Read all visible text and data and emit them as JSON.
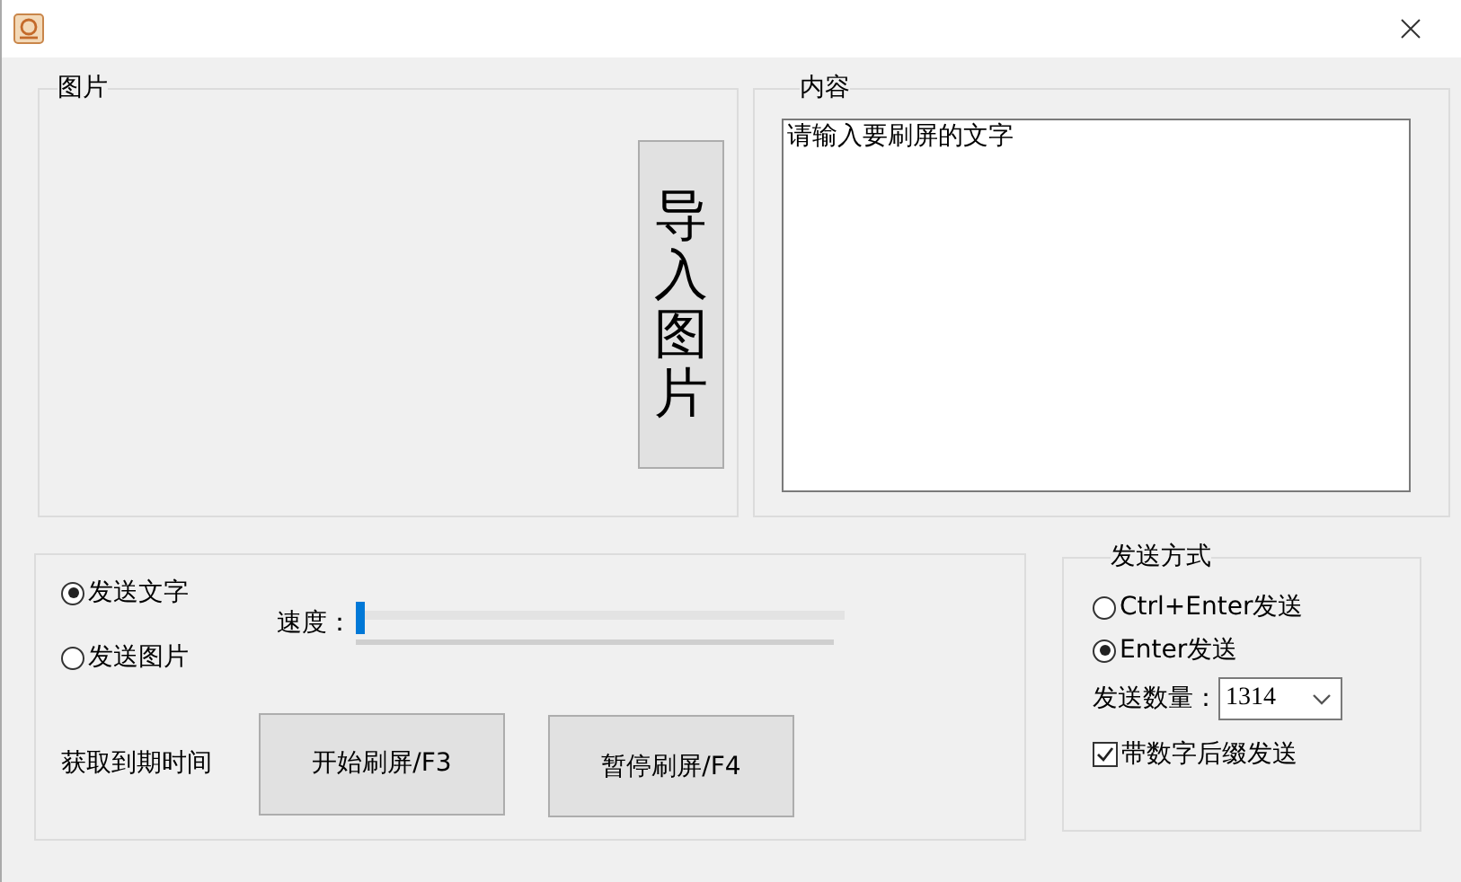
{
  "picture_group": {
    "label": "图片",
    "import_button": "导入图片"
  },
  "content_group": {
    "label": "内容",
    "text_value": "请输入要刷屏的文字"
  },
  "send_type": [
    {
      "label": "发送文字",
      "selected": true
    },
    {
      "label": "发送图片",
      "selected": false
    }
  ],
  "speed": {
    "label": "速度：",
    "level": 0
  },
  "expiry_label": "获取到期时间",
  "buttons": [
    "开始刷屏/F3",
    "暂停刷屏/F4"
  ],
  "send_mode": {
    "label": "发送方式",
    "options": [
      {
        "label": "Ctrl+Enter发送",
        "selected": false
      },
      {
        "label": "Enter发送",
        "selected": true
      }
    ],
    "count_label": "发送数量：",
    "count_value": "1314",
    "suffix": {
      "label": "带数字后缀发送",
      "checked": true
    }
  }
}
